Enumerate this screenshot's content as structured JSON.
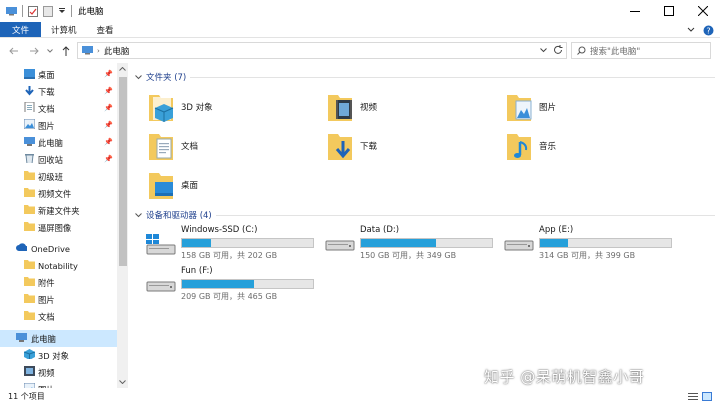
{
  "window": {
    "title": "此电脑"
  },
  "ribbon": {
    "tabs": [
      "文件",
      "计算机",
      "查看"
    ]
  },
  "address": {
    "path": "此电脑",
    "search_placeholder": "搜索\"此电脑\""
  },
  "sidebar": {
    "quick_access": [
      {
        "label": "桌面",
        "icon": "desktop-icon",
        "pinned": true
      },
      {
        "label": "下载",
        "icon": "download-icon",
        "pinned": true
      },
      {
        "label": "文档",
        "icon": "document-icon",
        "pinned": true
      },
      {
        "label": "图片",
        "icon": "pictures-icon",
        "pinned": true
      },
      {
        "label": "此电脑",
        "icon": "this-pc-icon",
        "pinned": true
      },
      {
        "label": "回收站",
        "icon": "recycle-bin-icon",
        "pinned": true
      },
      {
        "label": "初级班",
        "icon": "folder-icon",
        "pinned": false
      },
      {
        "label": "视频文件",
        "icon": "folder-icon",
        "pinned": false
      },
      {
        "label": "新建文件夹",
        "icon": "folder-icon",
        "pinned": false
      },
      {
        "label": "逼屏图像",
        "icon": "folder-icon",
        "pinned": false
      }
    ],
    "onedrive": {
      "label": "OneDrive",
      "items": [
        "Notability",
        "附件",
        "图片",
        "文档"
      ]
    },
    "this_pc": {
      "label": "此电脑",
      "items": [
        "3D 对象",
        "视频",
        "图片"
      ]
    }
  },
  "folders_group": {
    "header": "文件夹 (7)",
    "items": [
      {
        "label": "3D 对象",
        "icon": "3d-objects-folder-icon"
      },
      {
        "label": "视频",
        "icon": "videos-folder-icon"
      },
      {
        "label": "图片",
        "icon": "pictures-folder-icon"
      },
      {
        "label": "文档",
        "icon": "documents-folder-icon"
      },
      {
        "label": "下载",
        "icon": "downloads-folder-icon"
      },
      {
        "label": "音乐",
        "icon": "music-folder-icon"
      },
      {
        "label": "桌面",
        "icon": "desktop-folder-icon"
      }
    ]
  },
  "drives_group": {
    "header": "设备和驱动器 (4)",
    "drives": [
      {
        "name": "Windows-SSD (C:)",
        "info": "158 GB 可用，共 202 GB",
        "used_fraction": 0.22
      },
      {
        "name": "Data (D:)",
        "info": "150 GB 可用，共 349 GB",
        "used_fraction": 0.57
      },
      {
        "name": "App (E:)",
        "info": "314 GB 可用，共 399 GB",
        "used_fraction": 0.21
      },
      {
        "name": "Fun (F:)",
        "info": "209 GB 可用，共 465 GB",
        "used_fraction": 0.55
      }
    ]
  },
  "status": {
    "count": "11 个项目"
  },
  "watermark": "知乎 @呆萌机智鑫小哥",
  "colors": {
    "accent": "#1e64b8",
    "selection": "#cce8ff",
    "drive_fill": "#26a0da",
    "folder": "#f3c95d"
  }
}
